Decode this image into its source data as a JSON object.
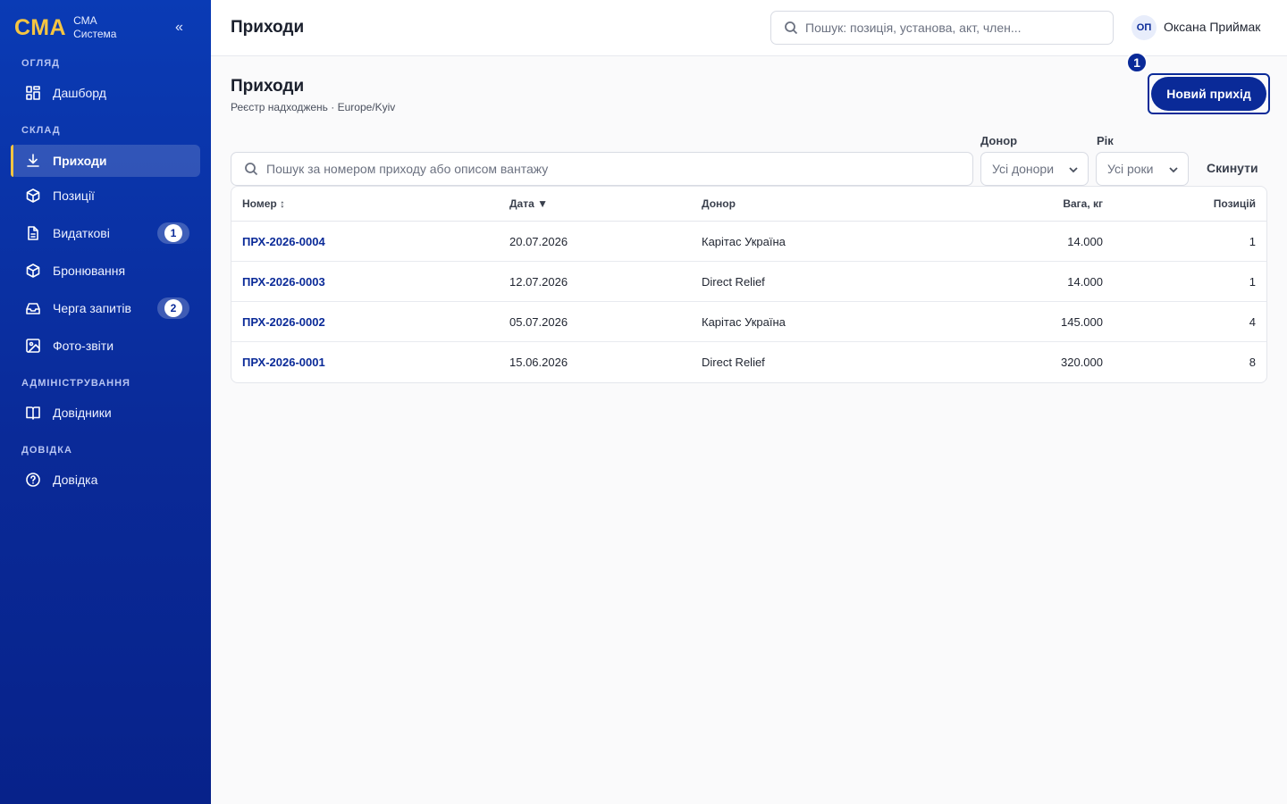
{
  "brand": {
    "logo": "СМА",
    "line1": "СМА",
    "line2": "Система",
    "collapse": "«"
  },
  "sidebar": {
    "sections": [
      "ОГЛЯД",
      "СКЛАД",
      "АДМІНІСТРУВАННЯ",
      "ДОВІДКА"
    ],
    "items": [
      {
        "label": "Дашборд",
        "icon": "dashboard-icon"
      },
      {
        "label": "Приходи",
        "icon": "download-icon",
        "active": true
      },
      {
        "label": "Позиції",
        "icon": "box-icon"
      },
      {
        "label": "Видаткові",
        "icon": "document-icon",
        "badge": "1"
      },
      {
        "label": "Бронювання",
        "icon": "box-icon"
      },
      {
        "label": "Черга запитів",
        "icon": "inbox-icon",
        "badge": "2"
      },
      {
        "label": "Фото-звіти",
        "icon": "image-icon"
      },
      {
        "label": "Довідники",
        "icon": "book-icon"
      },
      {
        "label": "Довідка",
        "icon": "help-icon"
      }
    ]
  },
  "header": {
    "title": "Приходи",
    "search_placeholder": "Пошук: позиція, установа, акт, член...",
    "user_initials": "ОП",
    "user_name": "Оксана Приймак"
  },
  "main": {
    "title": "Приходи",
    "subtitle": "Реєстр надходжень · Europe/Kyiv",
    "new_button": "Новий прихід",
    "marker": "1",
    "search_placeholder": "Пошук за номером приходу або описом вантажу",
    "donor_label": "Донор",
    "donor_value": "Усі донори",
    "year_label": "Рік",
    "year_value": "Усі роки",
    "reset": "Скинути"
  },
  "table": {
    "columns": [
      "Номер ↕",
      "Дата ▼",
      "Донор",
      "Вага, кг",
      "Позицій"
    ],
    "rows": [
      [
        "ПРХ-2026-0004",
        "20.07.2026",
        "Карітас Україна",
        "14.000",
        "1"
      ],
      [
        "ПРХ-2026-0003",
        "12.07.2026",
        "Direct Relief",
        "14.000",
        "1"
      ],
      [
        "ПРХ-2026-0002",
        "05.07.2026",
        "Карітас Україна",
        "145.000",
        "4"
      ],
      [
        "ПРХ-2026-0001",
        "15.06.2026",
        "Direct Relief",
        "320.000",
        "8"
      ]
    ]
  },
  "colors": {
    "sidebar": "#0a2a98",
    "accent": "#f5c542",
    "primary": "#0a2a98"
  }
}
